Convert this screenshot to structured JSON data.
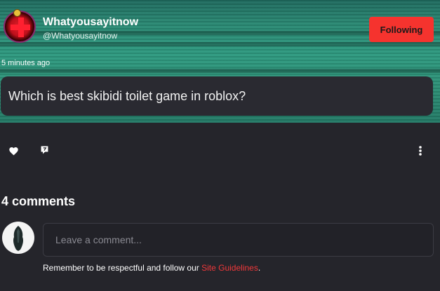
{
  "post": {
    "author_name": "Whatyousayitnow",
    "author_handle": "@Whatyousayitnow",
    "follow_label": "Following",
    "timestamp": "5 minutes ago",
    "question": "Which is best skibidi toilet game in roblox?"
  },
  "actions": {
    "like_icon": "heart-icon",
    "share_icon": "share-icon",
    "more_icon": "more-vertical-icon"
  },
  "comments": {
    "title": "4 comments",
    "input_placeholder": "Leave a comment...",
    "guidelines_prefix": "Remember to be respectful and follow our ",
    "guidelines_link": "Site Guidelines",
    "guidelines_suffix": "."
  },
  "colors": {
    "accent": "#f5332e",
    "background": "#25252b",
    "hero": "#2e9a80"
  }
}
